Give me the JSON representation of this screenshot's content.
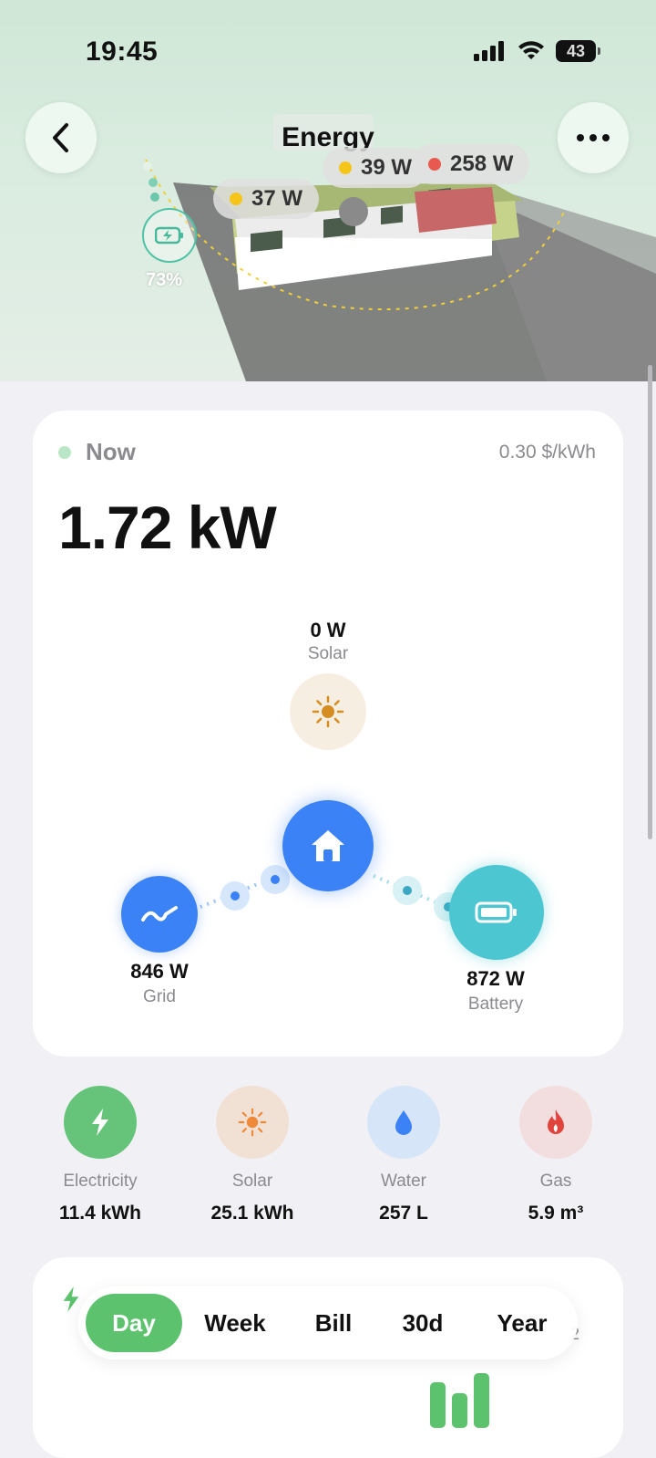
{
  "status_bar": {
    "time": "19:45",
    "battery": "43"
  },
  "header": {
    "title": "Energy"
  },
  "hero": {
    "tags": [
      {
        "label": "37 W",
        "dot": "#f5c51a"
      },
      {
        "label": "39 W",
        "dot": "#f5c51a"
      },
      {
        "label": "258 W",
        "dot": "#e85a4f"
      }
    ],
    "battery_percent": "73%"
  },
  "now_card": {
    "label": "Now",
    "price": "0.30 $/kWh",
    "total_power": "1.72 kW",
    "solar": {
      "value": "0 W",
      "label": "Solar"
    },
    "grid": {
      "value": "846 W",
      "label": "Grid"
    },
    "battery": {
      "value": "872 W",
      "label": "Battery"
    }
  },
  "categories": [
    {
      "name": "Electricity",
      "value": "11.4 kWh",
      "color": "#66c47a",
      "icon": "bolt-icon"
    },
    {
      "name": "Solar",
      "value": "25.1 kWh",
      "color": "#f1e1d4",
      "icon": "sun-icon"
    },
    {
      "name": "Water",
      "value": "257 L",
      "color": "#d6e5f7",
      "icon": "water-drop-icon"
    },
    {
      "name": "Gas",
      "value": "5.9 m³",
      "color": "#f2dede",
      "icon": "flame-icon"
    }
  ],
  "period_tabs": {
    "items": [
      "Day",
      "Week",
      "Bill",
      "30d",
      "Year"
    ],
    "selected": "Day"
  },
  "chart_card": {
    "axis_label": "2"
  },
  "colors": {
    "accent_green": "#5cc26d",
    "grid_blue": "#3b82f6",
    "battery_teal": "#4cc6d1"
  }
}
